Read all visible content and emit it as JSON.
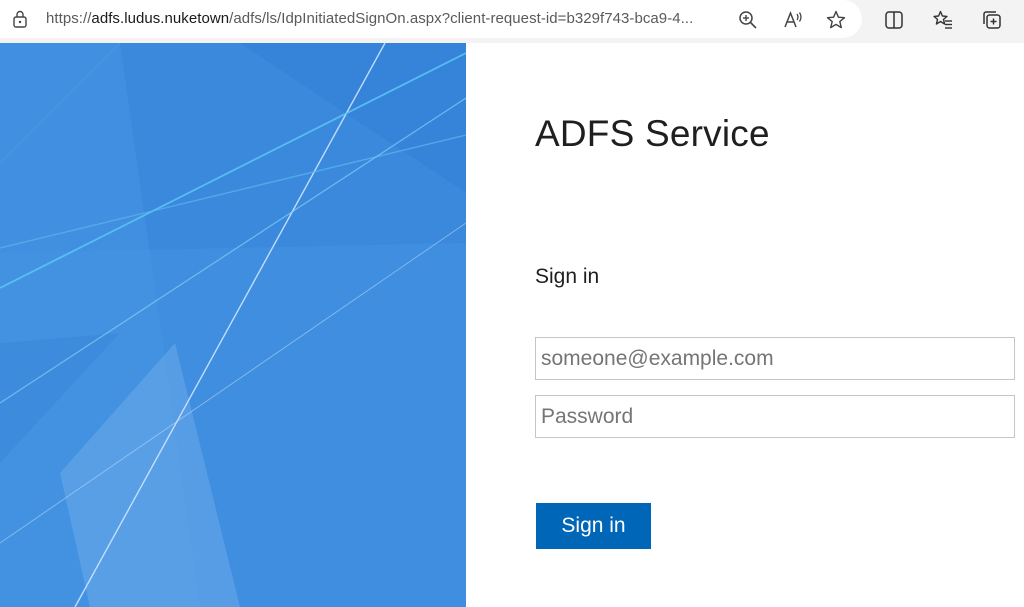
{
  "browser": {
    "url_prefix": "https://",
    "url_host": "adfs.ludus.nuketown",
    "url_path": "/adfs/ls/IdpInitiatedSignOn.aspx?client-request-id=b329f743-bca9-4...",
    "icons": [
      "lock-icon",
      "zoom-icon",
      "read-aloud-icon",
      "favorite-star-icon",
      "split-screen-icon",
      "favorites-icon",
      "collections-icon"
    ]
  },
  "form": {
    "title": "ADFS Service",
    "subtitle": "Sign in",
    "email_placeholder": "someone@example.com",
    "email_value": "",
    "password_placeholder": "Password",
    "password_value": "",
    "submit_label": "Sign in"
  },
  "colors": {
    "hero_blue": "#3f8ee0",
    "button_blue": "#0067b8"
  }
}
